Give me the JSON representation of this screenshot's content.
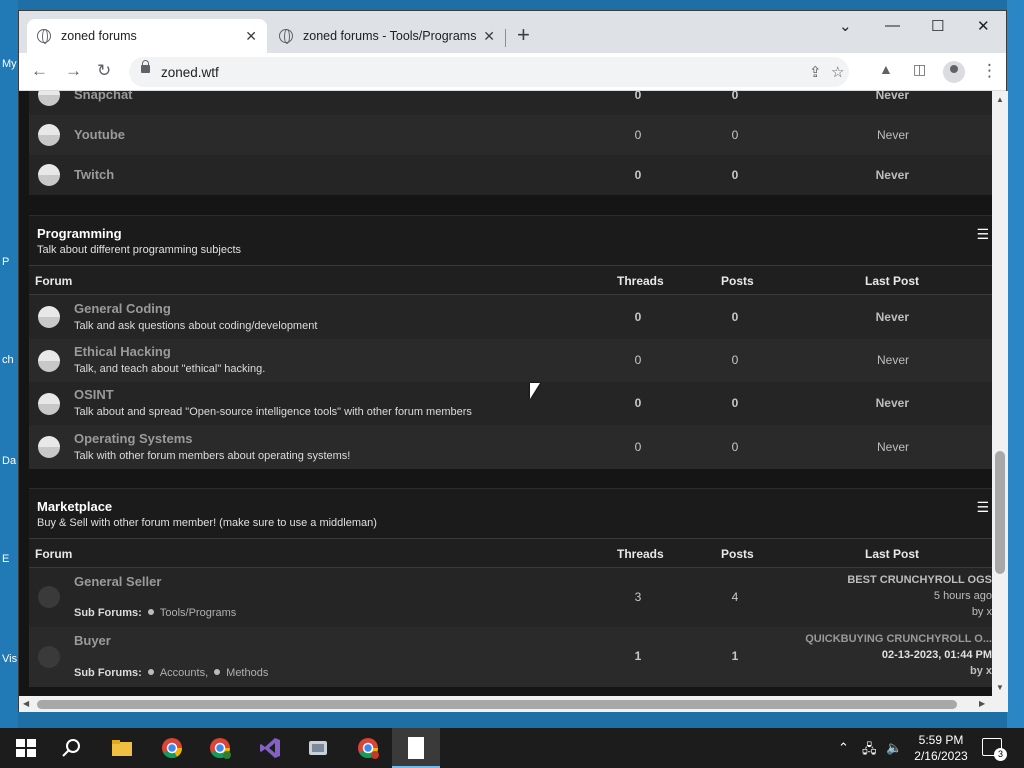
{
  "desktop": {
    "labels": [
      "My",
      "P",
      "ch",
      "Da",
      "E",
      "Vis"
    ]
  },
  "browser": {
    "tabs": [
      {
        "title": "zoned forums",
        "active": true
      },
      {
        "title": "zoned forums - Tools/Programs",
        "active": false
      }
    ],
    "url": "zoned.wtf"
  },
  "social_rows": [
    {
      "name": "Snapchat",
      "threads": "0",
      "posts": "0",
      "last_post": "Never"
    },
    {
      "name": "Youtube",
      "threads": "0",
      "posts": "0",
      "last_post": "Never"
    },
    {
      "name": "Twitch",
      "threads": "0",
      "posts": "0",
      "last_post": "Never"
    }
  ],
  "programming": {
    "title": "Programming",
    "description": "Talk about different programming subjects",
    "headers": {
      "forum": "Forum",
      "threads": "Threads",
      "posts": "Posts",
      "last_post": "Last Post"
    },
    "forums": [
      {
        "name": "General Coding",
        "desc": "Talk and ask questions about coding/development",
        "threads": "0",
        "posts": "0",
        "last_post": "Never"
      },
      {
        "name": "Ethical Hacking",
        "desc": "Talk, and teach about \"ethical\" hacking.",
        "threads": "0",
        "posts": "0",
        "last_post": "Never"
      },
      {
        "name": "OSINT",
        "desc": "Talk about and spread \"Open-source intelligence tools\" with other forum members",
        "threads": "0",
        "posts": "0",
        "last_post": "Never"
      },
      {
        "name": "Operating Systems",
        "desc": "Talk with other forum members about operating systems!",
        "threads": "0",
        "posts": "0",
        "last_post": "Never"
      }
    ]
  },
  "marketplace": {
    "title": "Marketplace",
    "description": "Buy & Sell with other forum member! (make sure to use a middleman)",
    "headers": {
      "forum": "Forum",
      "threads": "Threads",
      "posts": "Posts",
      "last_post": "Last Post"
    },
    "forums": [
      {
        "name": "General Seller",
        "sub_label": "Sub Forums:",
        "subs": [
          "Tools/Programs"
        ],
        "threads": "3",
        "posts": "4",
        "last_title": "BEST CRUNCHYROLL OGS",
        "last_time": "5 hours ago",
        "last_by": "by x"
      },
      {
        "name": "Buyer",
        "sub_label": "Sub Forums:",
        "subs": [
          "Accounts,",
          "Methods"
        ],
        "threads": "1",
        "posts": "1",
        "last_title": "QUICKBUYING CRUNCHYROLL O...",
        "last_time": "02-13-2023, 01:44 PM",
        "last_by": "by x"
      }
    ]
  },
  "taskbar": {
    "time": "5:59 PM",
    "date": "2/16/2023",
    "notification_count": "3"
  }
}
